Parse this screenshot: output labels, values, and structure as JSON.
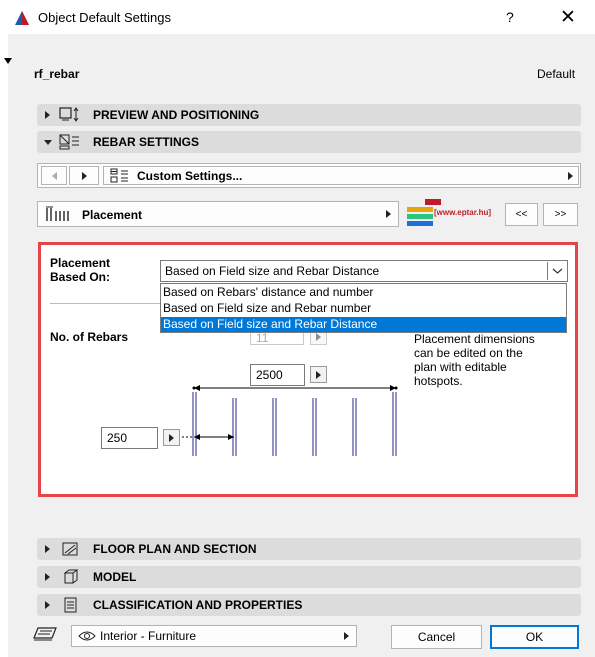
{
  "window": {
    "title": "Object Default Settings",
    "help": "?",
    "close": "✕"
  },
  "object": {
    "name": "rf_rebar",
    "default_label": "Default"
  },
  "sections": {
    "preview": "PREVIEW AND POSITIONING",
    "rebar": "REBAR SETTINGS",
    "floor_plan": "FLOOR PLAN AND SECTION",
    "model": "MODEL",
    "classification": "CLASSIFICATION AND PROPERTIES"
  },
  "toolbar": {
    "custom_settings": "Custom Settings...",
    "placement": "Placement",
    "eptar": "[www.eptar.hu]",
    "prev": "<<",
    "next": ">>"
  },
  "placement": {
    "label_line1": "Placement",
    "label_line2": "Based On:",
    "selected": "Based on Field size and Rebar Distance",
    "options": [
      "Based on Rebars' distance and number",
      "Based on Field size and Rebar number",
      "Based on Field size and Rebar Distance"
    ],
    "no_of_rebars_label": "No. of Rebars",
    "no_of_rebars_value": "11",
    "field_size": "2500",
    "distance": "250",
    "info_text": [
      "Placement dimensions",
      "can be edited on the",
      "plan with editable",
      "hotspots."
    ]
  },
  "footer": {
    "layer": "Interior - Furniture",
    "cancel": "Cancel",
    "ok": "OK"
  },
  "colors": {
    "highlight_border": "#e4444a",
    "selection": "#0078d7"
  }
}
